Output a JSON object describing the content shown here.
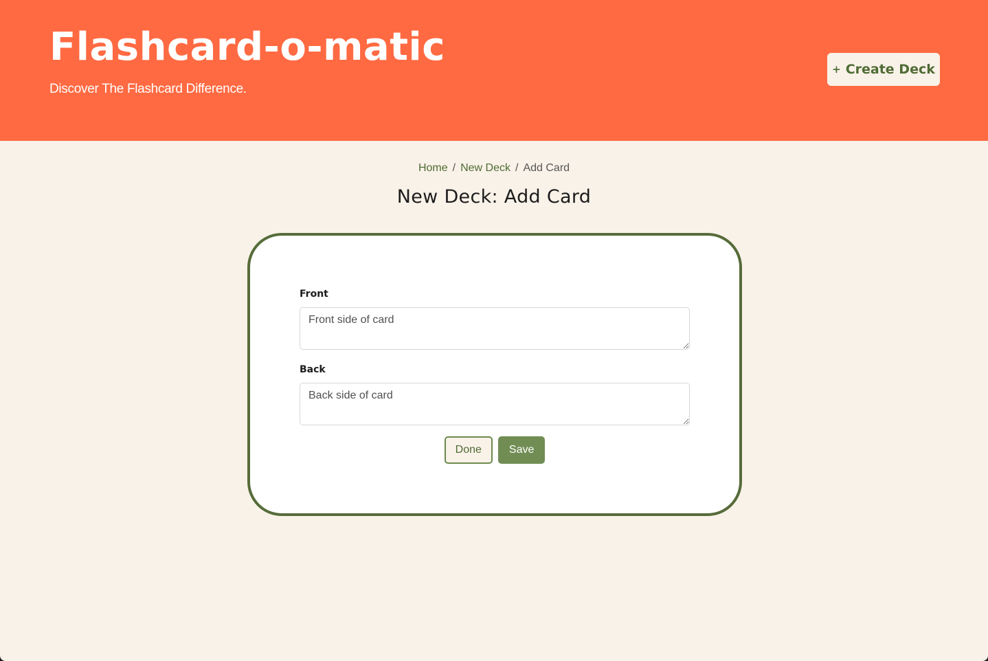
{
  "header": {
    "title": "Flashcard-o-matic",
    "tagline": "Discover The Flashcard Difference.",
    "create_deck_label": "Create Deck",
    "create_deck_icon": "plus-icon"
  },
  "breadcrumb": {
    "items": [
      "Home",
      "New Deck"
    ],
    "current": "Add Card",
    "separator": "/"
  },
  "page": {
    "title": "New Deck: Add Card"
  },
  "form": {
    "front_label": "Front",
    "front_placeholder": "Front side of card",
    "front_value": "",
    "back_label": "Back",
    "back_placeholder": "Back side of card",
    "back_value": "",
    "done_label": "Done",
    "save_label": "Save"
  },
  "colors": {
    "header_bg": "#ff6a42",
    "page_bg": "#f9f2e8",
    "accent_green": "#566c3a",
    "button_green": "#718d54"
  }
}
